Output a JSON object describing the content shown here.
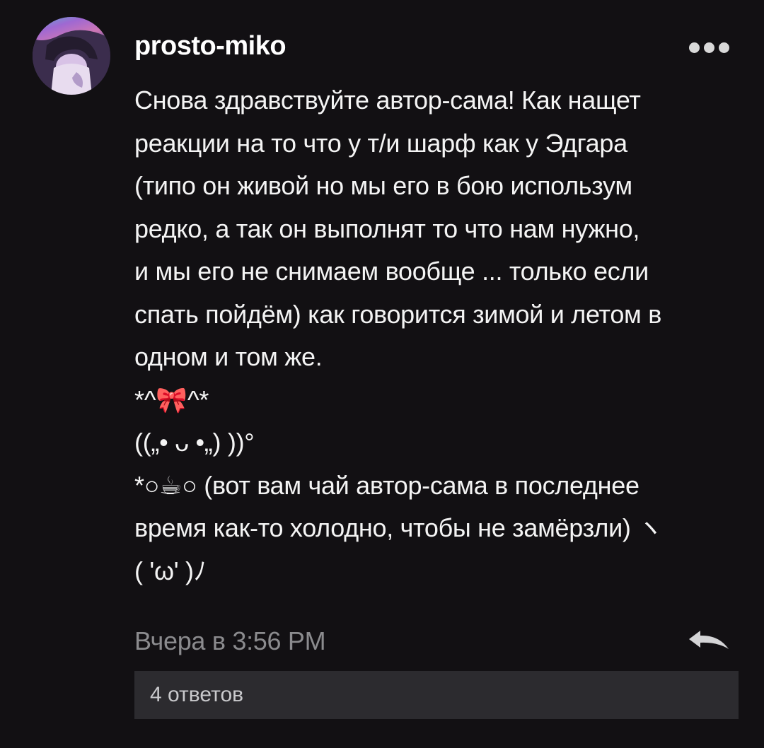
{
  "post": {
    "author": "prosto-miko",
    "more_icon": "more-dots-icon",
    "lines": [
      "Снова здравствуйте автор-сама! Как нащет",
      "реакции на то что у т/и шарф как у Эдгара",
      "(типо он живой но мы его в бою использум",
      "редко, а так он выполнят то что нам нужно,",
      "и мы его не снимаем вообще ... только если",
      "спать пойдём) как говорится зимой и летом в",
      "одном и том же.",
      "*^🎀^*",
      "((„• ᴗ •„) ))°",
      "*○☕○ (вот вам чай автор-сама в последнее",
      "время как-то холодно, чтобы не замёрзли) ヽ",
      "( 'ω' )ﾉ"
    ],
    "timestamp": "Вчера в 3:56 PM",
    "reply_icon": "reply-arrow-icon",
    "replies_label": "4 ответов"
  },
  "colors": {
    "background": "#121013",
    "text": "#f4f4f4",
    "muted": "#8b8b8e",
    "replies_bg": "#2c2b2f"
  }
}
